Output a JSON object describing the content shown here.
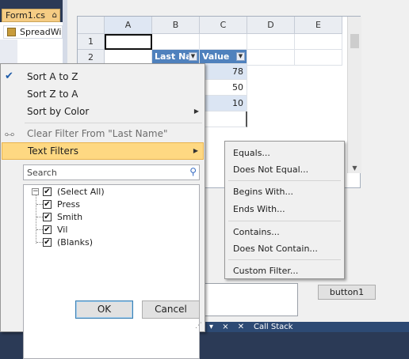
{
  "ide": {
    "tab_label": "Form1.cs",
    "tab_pin": "⌂",
    "tree_item": "SpreadWi",
    "bottom_bar_icons": "▾ ⨯ ✕",
    "bottom_bar_label": "Call Stack"
  },
  "spreadsheet": {
    "columns": [
      "A",
      "B",
      "C",
      "D",
      "E"
    ],
    "rows": [
      "1",
      "2"
    ],
    "header_cells": {
      "last_name": "Last Na",
      "value": "Value"
    },
    "values": [
      "78",
      "50",
      "10"
    ]
  },
  "form": {
    "button1_label": "button1"
  },
  "filter_menu": {
    "sort_a_to_z": "Sort A to Z",
    "sort_z_to_a": "Sort Z to A",
    "sort_by_color": "Sort by Color",
    "clear_filter": "Clear Filter From \"Last Name\"",
    "text_filters": "Text Filters",
    "search_placeholder": "Search",
    "items": [
      {
        "label": "(Select All)",
        "checked": true
      },
      {
        "label": "Press",
        "checked": true
      },
      {
        "label": "Smith",
        "checked": true
      },
      {
        "label": "Vil",
        "checked": true
      },
      {
        "label": "(Blanks)",
        "checked": true
      }
    ],
    "ok_label": "OK",
    "cancel_label": "Cancel",
    "check_glyph": "✔"
  },
  "text_filters_submenu": {
    "equals": "Equals...",
    "does_not_equal": "Does Not Equal...",
    "begins_with": "Begins With...",
    "ends_with": "Ends With...",
    "contains": "Contains...",
    "does_not_contain": "Does Not Contain...",
    "custom_filter": "Custom Filter..."
  },
  "colors": {
    "highlight": "#fed882",
    "table_header": "#4f81bd",
    "ide_dark": "#2b3a56"
  }
}
